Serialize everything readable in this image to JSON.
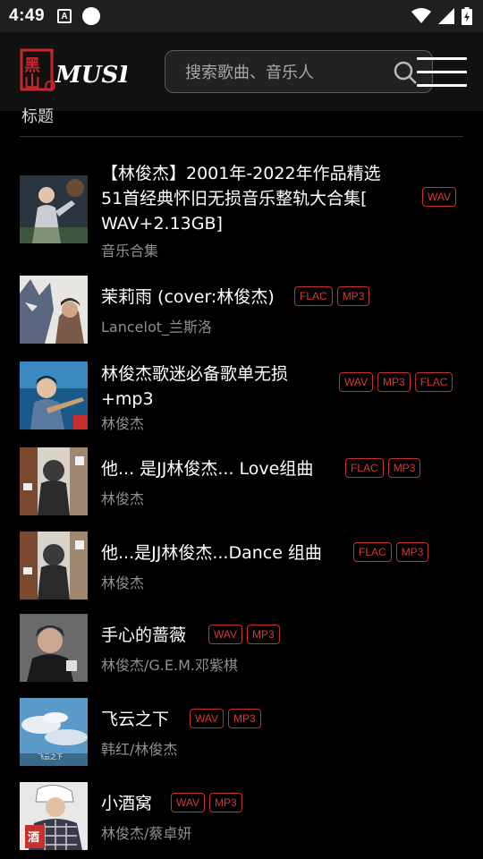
{
  "status_bar": {
    "time": "4:49",
    "notification_letter": "A"
  },
  "header": {
    "logo_text": "MUSIC",
    "search_placeholder": "搜索歌曲、音乐人"
  },
  "section": {
    "title": "标题"
  },
  "colors": {
    "tag_red": "#d23a37",
    "background": "#000000",
    "header_bg": "#111111"
  },
  "items": [
    {
      "title_lines": [
        "【林俊杰】2001年-2022年作品精选",
        "51首经典怀旧无损音乐整轨大合集[",
        "WAV+2.13GB]"
      ],
      "subtitle": "音乐合集",
      "tags": [
        "WAV"
      ]
    },
    {
      "title_lines": [
        "茉莉雨 (cover:林俊杰)"
      ],
      "subtitle": "Lancelot_兰斯洛",
      "tags": [
        "FLAC",
        "MP3"
      ]
    },
    {
      "title_lines": [
        "林俊杰歌迷必备歌单无损",
        "+mp3"
      ],
      "subtitle": "林俊杰",
      "tags": [
        "WAV",
        "MP3",
        "FLAC"
      ]
    },
    {
      "title_lines": [
        "他... 是JJ林俊杰... Love组曲"
      ],
      "subtitle": "林俊杰",
      "tags": [
        "FLAC",
        "MP3"
      ]
    },
    {
      "title_lines": [
        "他...是JJ林俊杰...Dance 组曲"
      ],
      "subtitle": "林俊杰",
      "tags": [
        "FLAC",
        "MP3"
      ]
    },
    {
      "title_lines": [
        "手心的蔷薇"
      ],
      "subtitle": "林俊杰/G.E.M.邓紫棋",
      "tags": [
        "WAV",
        "MP3"
      ]
    },
    {
      "title_lines": [
        "飞云之下"
      ],
      "subtitle": "韩红/林俊杰",
      "tags": [
        "WAV",
        "MP3"
      ]
    },
    {
      "title_lines": [
        "小酒窝"
      ],
      "subtitle": "林俊杰/蔡卓妍",
      "tags": [
        "WAV",
        "MP3"
      ]
    }
  ]
}
